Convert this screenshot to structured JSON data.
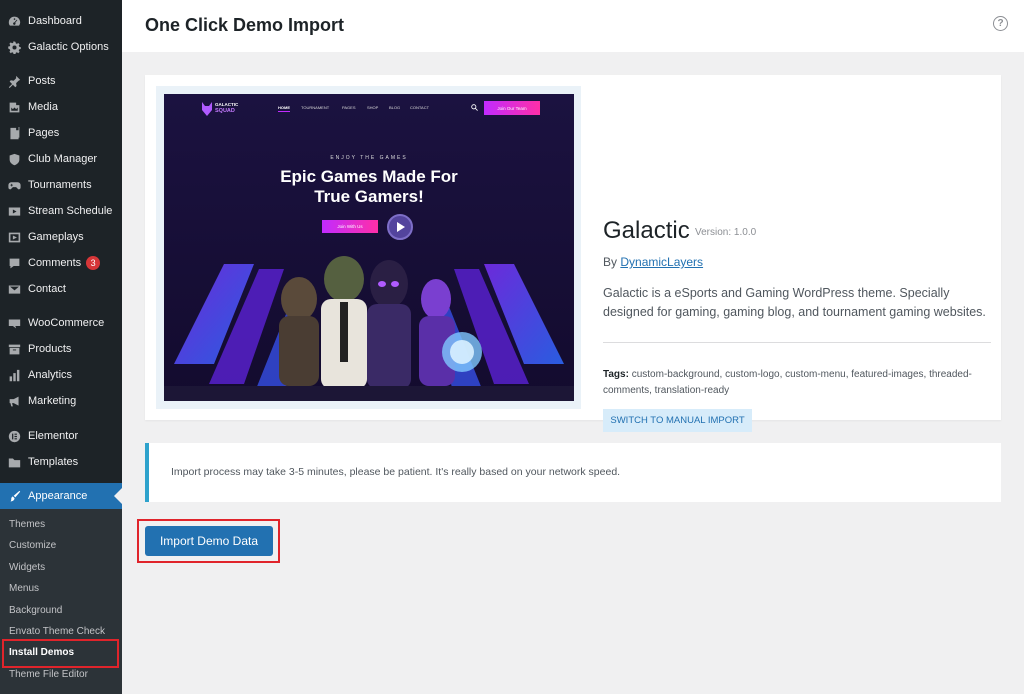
{
  "sidebar": {
    "items": [
      {
        "label": "Dashboard",
        "icon": "dashboard-icon"
      },
      {
        "label": "Galactic Options",
        "icon": "gear-icon"
      },
      {
        "label": "Posts",
        "icon": "pin-icon"
      },
      {
        "label": "Media",
        "icon": "media-icon"
      },
      {
        "label": "Pages",
        "icon": "pages-icon"
      },
      {
        "label": "Club Manager",
        "icon": "shield-icon"
      },
      {
        "label": "Tournaments",
        "icon": "gamepad-icon"
      },
      {
        "label": "Stream Schedule",
        "icon": "video-icon"
      },
      {
        "label": "Gameplays",
        "icon": "play-icon"
      },
      {
        "label": "Comments",
        "icon": "comment-icon",
        "badge": "3"
      },
      {
        "label": "Contact",
        "icon": "mail-icon"
      },
      {
        "label": "WooCommerce",
        "icon": "woo-icon"
      },
      {
        "label": "Products",
        "icon": "archive-icon"
      },
      {
        "label": "Analytics",
        "icon": "chart-icon"
      },
      {
        "label": "Marketing",
        "icon": "megaphone-icon"
      },
      {
        "label": "Elementor",
        "icon": "elementor-icon"
      },
      {
        "label": "Templates",
        "icon": "folder-icon"
      },
      {
        "label": "Appearance",
        "icon": "brush-icon"
      }
    ],
    "submenu": [
      "Themes",
      "Customize",
      "Widgets",
      "Menus",
      "Background",
      "Envato Theme Check",
      "Install Demos",
      "Theme File Editor"
    ]
  },
  "header": {
    "title": "One Click Demo Import",
    "help": "?"
  },
  "theme": {
    "name": "Galactic",
    "version": "Version: 1.0.0",
    "by": "By",
    "author": "DynamicLayers",
    "description": "Galactic is a eSports and Gaming WordPress theme. Specially designed for gaming, gaming blog, and tournament gaming websites.",
    "tags_label": "Tags:",
    "tags": "custom-background, custom-logo, custom-menu, featured-images, threaded-comments, translation-ready",
    "manual_button": "SWITCH TO MANUAL IMPORT"
  },
  "screenshot": {
    "logo_top": "GALACTIC",
    "logo_bottom": "SQUAD",
    "nav": [
      "HOME",
      "TOURNAMENT",
      "PAGES",
      "SHOP",
      "BLOG",
      "CONTACT"
    ],
    "cta": "Join Our Team",
    "kicker": "ENJOY THE GAMES",
    "headline_1": "Epic Games Made For",
    "headline_2": "True Gamers!",
    "join": "Join With Us"
  },
  "notice": {
    "text": "Import process may take 3-5 minutes, please be patient. It's really based on your network speed."
  },
  "import_button": "Import Demo Data",
  "colors": {
    "sidebar": "#1d2327",
    "accent": "#2271b1",
    "highlight": "#e0242b",
    "badge": "#d63638"
  }
}
